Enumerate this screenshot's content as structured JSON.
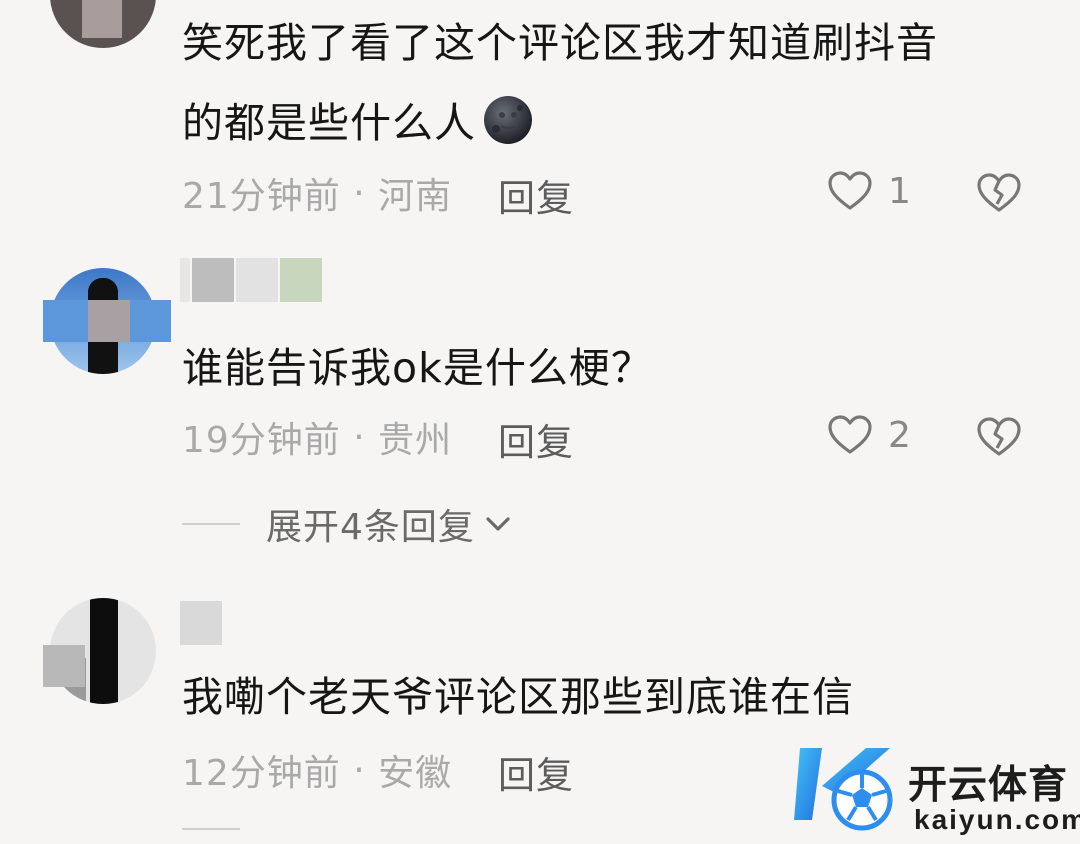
{
  "comments": [
    {
      "text_line1": "笑死我了看了这个评论区我才知道刷抖音",
      "text_line2": "的都是些什么人",
      "emoji": "new-moon-face-emoji",
      "time": "21分钟前",
      "separator": " · ",
      "location": "河南",
      "reply_label": "回复",
      "likes": "1"
    },
    {
      "text": "谁能告诉我ok是什么梗？",
      "time": "19分钟前",
      "separator": " · ",
      "location": "贵州",
      "reply_label": "回复",
      "likes": "2",
      "expand_label": "展开4条回复"
    },
    {
      "text": "我嘞个老天爷评论区那些到底谁在信",
      "time": "12分钟前",
      "separator": " · ",
      "location": "安徽",
      "reply_label": "回复"
    }
  ],
  "watermark": {
    "title": "开云体育",
    "subtitle": "kaiyun.com"
  },
  "colors": {
    "background": "#f6f5f4",
    "text": "#161616",
    "meta": "#a9a9a9",
    "watermark_blue": "#2d8ef0"
  }
}
